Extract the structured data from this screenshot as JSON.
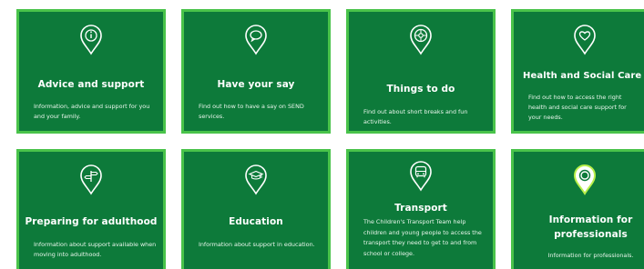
{
  "cards": [
    {
      "title": "Advice and support",
      "description": "Information, advice and support for you and your family.",
      "icon": "info-icon"
    },
    {
      "title": "Have your say",
      "description": "Find out how to have a say on SEND services.",
      "icon": "speech-bubble-icon"
    },
    {
      "title": "Things to do",
      "description": "Find out about short breaks and fun activities.",
      "icon": "ball-icon"
    },
    {
      "title": "Health and Social Care",
      "description": "Find out how to access the right health and social care support for your needs.",
      "icon": "heart-icon"
    },
    {
      "title": "Preparing for adulthood",
      "description": "Information about support available when moving into adulthood.",
      "icon": "signpost-icon"
    },
    {
      "title": "Education",
      "description": "Information about support in education.",
      "icon": "graduation-cap-icon"
    },
    {
      "title": "Transport",
      "description": "The Children's Transport Team help children and young people to access the transport they need to get to and from school or college.",
      "icon": "bus-icon"
    },
    {
      "title_line1": "Information for",
      "title_line2": "professionals",
      "description": "Information for professionals.",
      "icon": "target-icon"
    }
  ],
  "colors": {
    "card_bg": "#0d7a3a",
    "card_border": "#49c34a",
    "text": "#ffffff"
  }
}
